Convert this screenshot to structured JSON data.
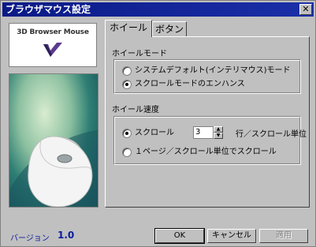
{
  "window": {
    "title": "ブラウザマウス設定"
  },
  "logo": {
    "text": "3D Browser Mouse"
  },
  "tabs": [
    {
      "label": "ホイール"
    },
    {
      "label": "ボタン"
    }
  ],
  "wheel_mode": {
    "heading": "ホイールモード",
    "options": [
      {
        "label": "システムデフォルト(インテリマウス)モード",
        "checked": false
      },
      {
        "label": "スクロールモードのエンハンス",
        "checked": true
      }
    ]
  },
  "wheel_speed": {
    "heading": "ホイール速度",
    "scroll_label": "スクロール",
    "scroll_value": "3",
    "unit_label": "行／スクロール単位",
    "page_label": "１ページ／スクロール単位でスクロール"
  },
  "footer": {
    "version_label": "バージョン",
    "version_value": "1.0",
    "ok_label": "OK",
    "cancel_label": "キャンセル",
    "apply_label": "適用"
  }
}
